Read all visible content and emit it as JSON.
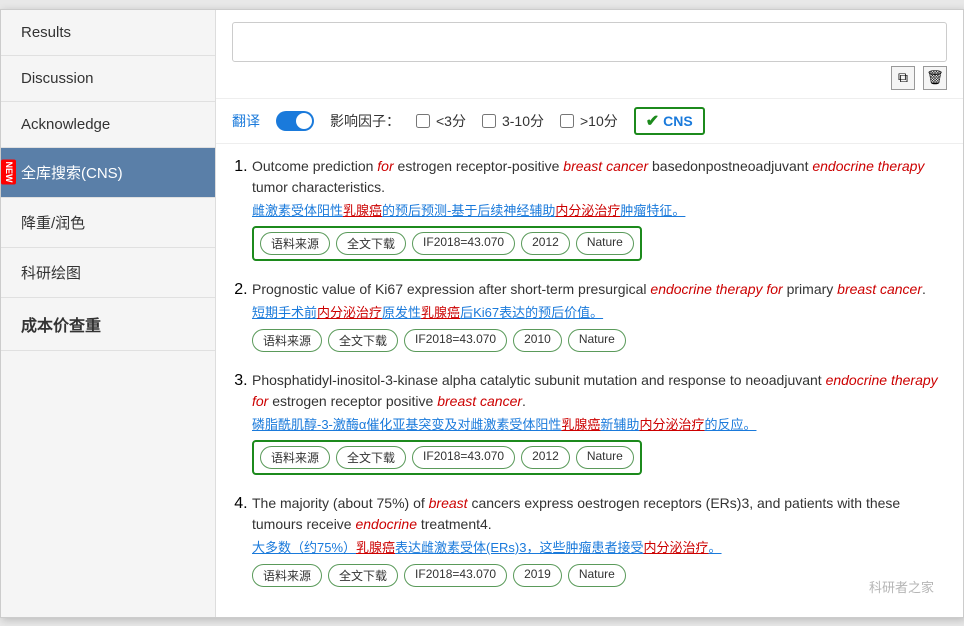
{
  "sidebar": {
    "items": [
      {
        "label": "Results",
        "active": false,
        "new": false
      },
      {
        "label": "Discussion",
        "active": false,
        "new": false
      },
      {
        "label": "Acknowledge",
        "active": false,
        "new": false
      },
      {
        "label": "全库搜索(CNS)",
        "active": true,
        "new": true
      },
      {
        "label": "降重/润色",
        "active": false,
        "new": false
      },
      {
        "label": "科研绘图",
        "active": false,
        "new": false
      },
      {
        "label": "成本价查重",
        "active": false,
        "new": false,
        "bold": true
      }
    ]
  },
  "filter": {
    "translate_label": "翻译",
    "impact_label": "影响因子：",
    "opt1": "<3分",
    "opt2": "3-10分",
    "opt3": ">10分",
    "cns_label": "CNS"
  },
  "results": [
    {
      "title_before": "Outcome prediction ",
      "title_italic1": "for",
      "title_mid1": " estrogen receptor-positive ",
      "title_italic2": "breast cancer",
      "title_mid2": " basedonpostneoadjuvant ",
      "title_italic3": "endocrine therapy",
      "title_end": " tumor characteristics.",
      "translation": "雌激素受体阳性乳腺癌的预后预测-基于后续神经辅助内分泌治疗肿瘤特征。",
      "tags": [
        "语料来源",
        "全文下载",
        "IF2018=43.070",
        "2012",
        "Nature"
      ],
      "boxed": true
    },
    {
      "title_before": "Prognostic value of Ki67 expression after short-term presurgical ",
      "title_italic1": "endocrine therapy for",
      "title_mid1": " primary ",
      "title_italic2": "breast cancer",
      "title_mid2": "",
      "title_italic3": "",
      "title_end": ".",
      "translation": "短期手术前内分泌治疗原发性乳腺癌后Ki67表达的预后价值。",
      "tags": [
        "语料来源",
        "全文下载",
        "IF2018=43.070",
        "2010",
        "Nature"
      ],
      "boxed": false
    },
    {
      "title_before": "Phosphatidyl-inositol-3-kinase alpha catalytic subunit mutation and response to neoadjuvant ",
      "title_italic1": "endocrine therapy for",
      "title_mid1": " estrogen receptor positive ",
      "title_italic2": "breast cancer",
      "title_mid2": "",
      "title_italic3": "",
      "title_end": ".",
      "translation": "磷脂酰肌醇-3-激酶α催化亚基突变及对雌激素受体阳性乳腺癌新辅助内分泌治疗的反应。",
      "tags": [
        "语料来源",
        "全文下载",
        "IF2018=43.070",
        "2012",
        "Nature"
      ],
      "boxed": true
    },
    {
      "title_before": "The majority (about 75%) of ",
      "title_italic1": "breast",
      "title_mid1": " cancers express oestrogen receptors (ERs)3, and patients with these tumours receive ",
      "title_italic2": "endocrine",
      "title_mid2": " treatment4.",
      "title_italic3": "",
      "title_end": "",
      "translation": "大多数（约75%）乳腺癌表达雌激素受体(ERs)3，这些肿瘤患者接受内分泌治疗。",
      "tags": [
        "语料来源",
        "全文下载",
        "IF2018=43.070",
        "2019",
        "Nature"
      ],
      "boxed": false
    }
  ],
  "watermark": "科研者之家"
}
